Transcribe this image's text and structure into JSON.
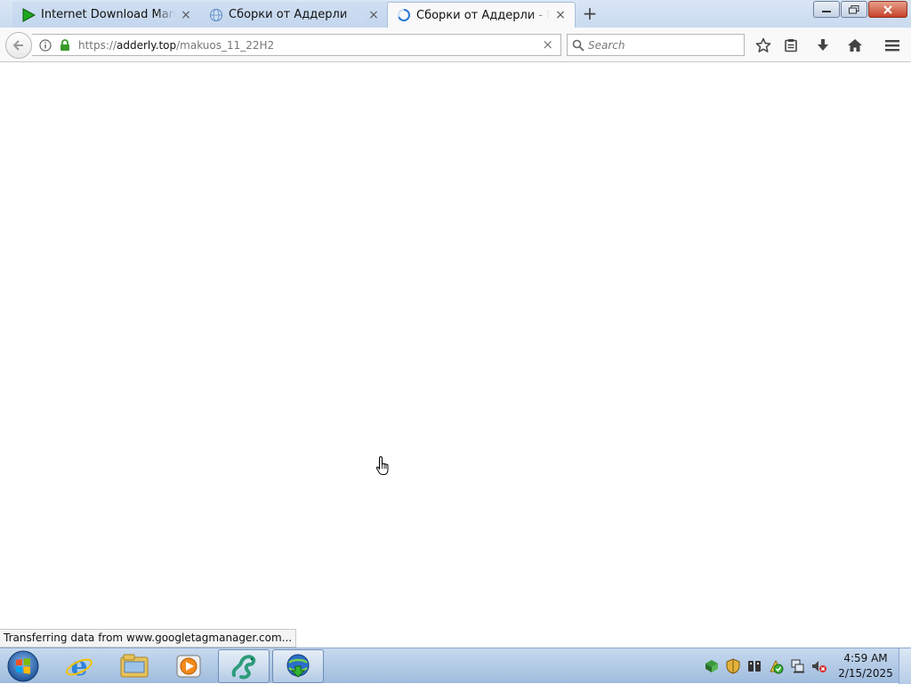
{
  "browser": {
    "tabs": [
      {
        "title": "Internet Download Manager",
        "icon": "idm-play-icon",
        "active": false
      },
      {
        "title": "Сборки от Аддерли",
        "icon": "globe-icon",
        "active": false
      },
      {
        "title": "Сборки от Аддерли - Makuos",
        "icon": "loading-spinner-icon",
        "active": true
      }
    ],
    "new_tab_label": "+",
    "close_glyph": "×",
    "url": {
      "scheme": "https://",
      "host": "adderly.top",
      "path": "/makuos_11_22H2"
    },
    "search_placeholder": "Search",
    "status_text": "Transferring data from www.googletagmanager.com..."
  },
  "taskbar": {
    "clock_time": "4:59 AM",
    "clock_date": "2/15/2025",
    "pinned": [
      "start-orb-icon",
      "internet-explorer-icon",
      "file-explorer-icon",
      "media-player-icon",
      "snake-app-icon",
      "idm-icon"
    ]
  },
  "colors": {
    "accent_tab": "#f9f9fa",
    "tabstrip": "#c9dbf0",
    "taskbar": "#9fbcde",
    "lock_green": "#3a9a2a"
  }
}
